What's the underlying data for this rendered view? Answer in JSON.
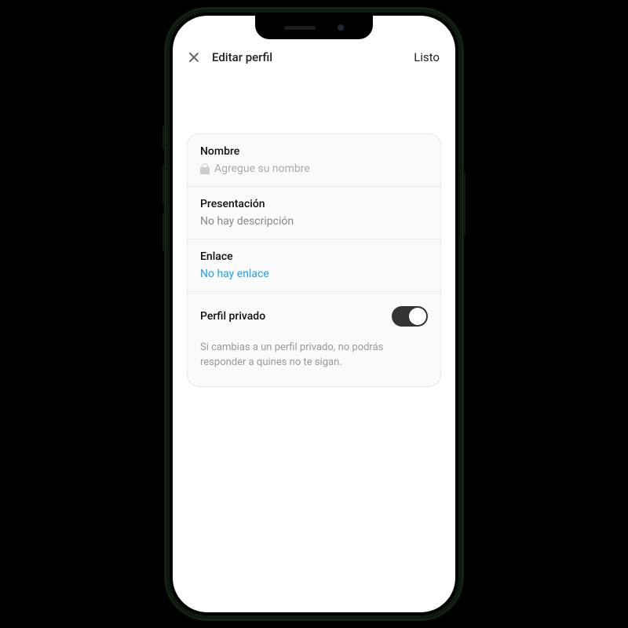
{
  "header": {
    "title": "Editar perfil",
    "done": "Listo"
  },
  "name_section": {
    "label": "Nombre",
    "placeholder": "Agregue su nombre"
  },
  "bio_section": {
    "label": "Presentación",
    "value": "No hay descripción"
  },
  "link_section": {
    "label": "Enlace",
    "value": "No hay enlace"
  },
  "privacy_section": {
    "label": "Perfil privado",
    "toggle_on": true,
    "helper": "Si cambias a un perfil privado, no podrás responder a quines no te sigan."
  }
}
